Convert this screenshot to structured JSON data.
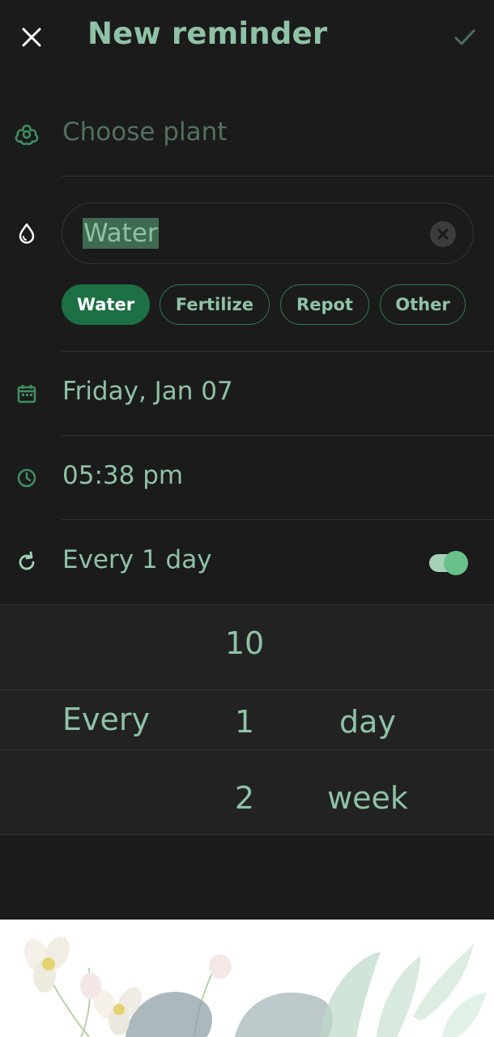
{
  "header": {
    "title": "New reminder",
    "close_icon": "close-icon",
    "confirm_icon": "check-icon"
  },
  "plant": {
    "icon": "flower-icon",
    "placeholder": "Choose plant"
  },
  "task": {
    "icon": "water-drop-icon",
    "value": "Water",
    "clear_icon": "clear-circle-icon",
    "chips": [
      {
        "label": "Water",
        "selected": true
      },
      {
        "label": "Fertilize",
        "selected": false
      },
      {
        "label": "Repot",
        "selected": false
      },
      {
        "label": "Other",
        "selected": false
      }
    ]
  },
  "date": {
    "icon": "calendar-icon",
    "value": "Friday, Jan 07"
  },
  "time": {
    "icon": "clock-icon",
    "value": "05:38 pm"
  },
  "repeat": {
    "icon": "repeat-icon",
    "label": "Every 1 day",
    "enabled": true
  },
  "picker": {
    "prefix": "Every",
    "numbers": [
      "10",
      "1",
      "2"
    ],
    "units": [
      "day",
      "week"
    ]
  },
  "colors": {
    "background": "#1b1b1b",
    "accent": "#8fc2a6",
    "chip_selected": "#1d7044",
    "toggle_on": "#69c08b"
  }
}
